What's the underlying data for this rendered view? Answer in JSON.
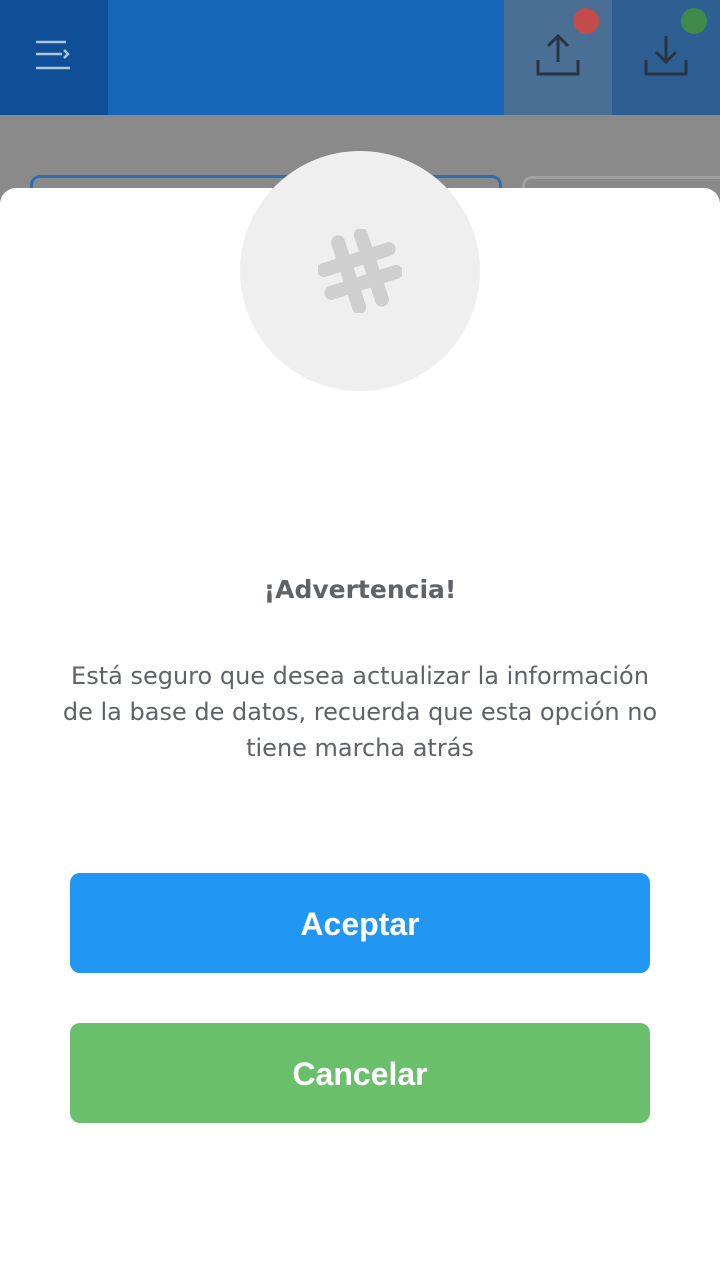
{
  "header": {
    "menu_icon": "menu-icon",
    "upload_icon": "upload-icon",
    "download_icon": "download-icon",
    "upload_status_color": "#c24b4b",
    "download_status_color": "#3f8a4a"
  },
  "dialog": {
    "icon": "hashtag-icon",
    "title": "¡Advertencia!",
    "message": "Está seguro que desea actualizar la información de la base de datos, recuerda que esta opción no tiene marcha atrás",
    "accept_label": "Aceptar",
    "cancel_label": "Cancelar",
    "accept_color": "#2196f3",
    "cancel_color": "#69bf6a"
  }
}
